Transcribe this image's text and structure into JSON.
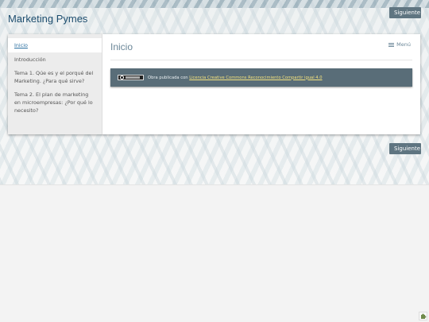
{
  "header": {
    "site_title": "Marketing Pymes",
    "next_button_top": "Siguiente"
  },
  "sidebar": {
    "items": [
      {
        "label": "Inicio",
        "active": true
      },
      {
        "label": "Introducción"
      },
      {
        "label": "Tema 1. Qúe es y el porqué del Marketing. ¿Para qué sirve?"
      },
      {
        "label": "Tema 2. El plan de marketing en microempresas: ¿Por qué lo necesito?"
      }
    ]
  },
  "main": {
    "heading": "Inicio",
    "menu_label": "Menú",
    "license": {
      "prefix": "Obra publicada con ",
      "link_text": "Licencia Creative Commons Reconocimiento Compartir igual 4.0"
    }
  },
  "footer": {
    "next_button_bottom": "Siguiente"
  },
  "icons": {
    "menu": "hamburger-icon",
    "cc": "creative-commons-badge-icon",
    "corner": "puzzle-icon"
  },
  "colors": {
    "title": "#1d4d6e",
    "button_bg": "#5f7581",
    "license_bg": "#596d78",
    "link": "#f4e27d"
  }
}
